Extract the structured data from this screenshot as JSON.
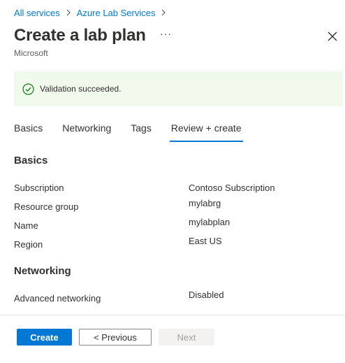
{
  "breadcrumb": {
    "items": [
      "All services",
      "Azure Lab Services"
    ],
    "separator": ">"
  },
  "header": {
    "title": "Create a lab plan",
    "subtitle": "Microsoft",
    "more_label": "···",
    "icons": {
      "close": "close-icon",
      "more": "more-icon"
    }
  },
  "banner": {
    "message": "Validation succeeded.",
    "icon": "success-check-icon",
    "colors": {
      "background": "#f1f8ec",
      "icon": "#107c10"
    }
  },
  "tabs": [
    {
      "label": "Basics",
      "active": false
    },
    {
      "label": "Networking",
      "active": false
    },
    {
      "label": "Tags",
      "active": false
    },
    {
      "label": "Review + create",
      "active": true
    }
  ],
  "basics": {
    "title": "Basics",
    "rows": [
      {
        "label": "Subscription",
        "value": "Contoso Subscription"
      },
      {
        "label": "Resource group",
        "value": "mylabrg"
      },
      {
        "label": "Name",
        "value": "mylabplan"
      },
      {
        "label": "Region",
        "value": "East US"
      }
    ]
  },
  "networking": {
    "title": "Networking",
    "rows": [
      {
        "label": "Advanced networking",
        "value": "Disabled"
      }
    ]
  },
  "footer": {
    "create_label": "Create",
    "previous_label": "< Previous",
    "next_label": "Next"
  },
  "colors": {
    "accent": "#0078d4",
    "text": "#323130"
  }
}
